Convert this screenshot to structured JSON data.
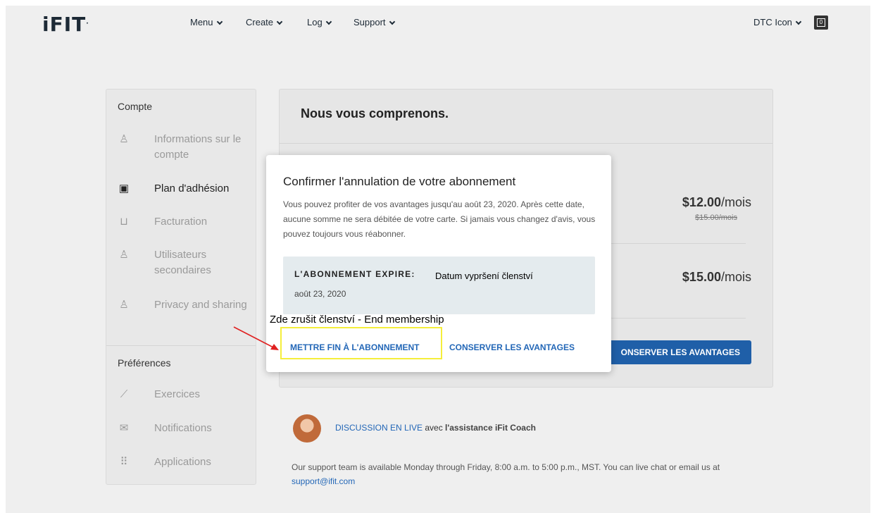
{
  "nav": {
    "logo": "iFIT",
    "items": [
      {
        "label": "Menu"
      },
      {
        "label": "Create"
      },
      {
        "label": "Log"
      },
      {
        "label": "Support"
      }
    ],
    "user_label": "DTC Icon",
    "cart_count": "0"
  },
  "sidebar": {
    "account_heading": "Compte",
    "account_items": [
      {
        "label": "Informations sur le compte",
        "icon": "user-icon"
      },
      {
        "label": "Plan d'adhésion",
        "icon": "id-card-icon",
        "active": true
      },
      {
        "label": "Facturation",
        "icon": "cart-icon"
      },
      {
        "label": "Utilisateurs secondaires",
        "icon": "add-user-icon"
      },
      {
        "label": "Privacy and sharing",
        "icon": "privacy-icon"
      }
    ],
    "prefs_heading": "Préférences",
    "prefs_items": [
      {
        "label": "Exercices",
        "icon": "dumbbell-icon"
      },
      {
        "label": "Notifications",
        "icon": "envelope-icon"
      },
      {
        "label": "Applications",
        "icon": "grid-icon"
      }
    ]
  },
  "card": {
    "title": "Nous vous comprenons.",
    "price1": "$12.00",
    "price1_unit": "/mois",
    "price1_old": "$15.00/mois",
    "price2": "$15.00",
    "price2_unit": "/mois",
    "behind_button": "ONSERVER LES AVANTAGES"
  },
  "coach": {
    "chat_link": "DISCUSSION EN LIVE",
    "chat_mid": " avec ",
    "chat_bold": "l'assistance iFit Coach",
    "support_text": "Our support team is available Monday through Friday, 8:00 a.m. to 5:00 p.m., MST. You can live chat or email us at ",
    "support_email": "support@ifit.com"
  },
  "modal": {
    "title": "Confirmer l'annulation de votre abonnement",
    "body": "Vous pouvez profiter de vos avantages jusqu'au août 23, 2020. Après cette date, aucune somme ne sera débitée de votre carte. Si jamais vous changez d'avis, vous pouvez toujours vous réabonner.",
    "expire_label": "L'ABONNEMENT EXPIRE:",
    "expire_date": "août 23, 2020",
    "end_button": "METTRE FIN À L'ABONNEMENT",
    "keep_button": "CONSERVER LES AVANTAGES"
  },
  "annotations": {
    "expiry_note": "Datum vypršení členství",
    "end_note": "Zde zrušit členství - End membership",
    "highlight_color": "#f5ee3b",
    "arrow_color": "#e02020"
  }
}
